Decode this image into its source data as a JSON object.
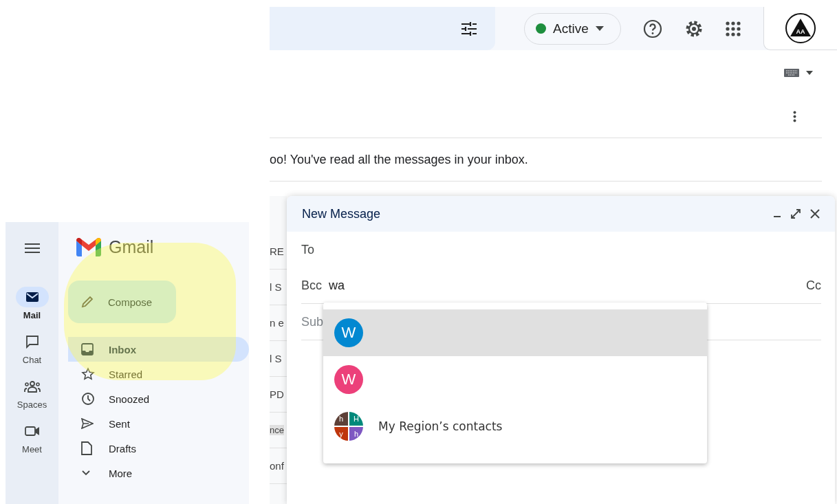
{
  "top_bar": {
    "status": {
      "label": "Active",
      "color": "#1e8e3e"
    },
    "account_logo": {
      "text": "AA"
    }
  },
  "mail_view": {
    "message": "oo! You've read all the messages in your inbox.",
    "list_fragments": [
      {
        "text": "RE",
        "kind": "text"
      },
      {
        "text": "l S",
        "kind": "text"
      },
      {
        "text": "n e",
        "kind": "text"
      },
      {
        "text": "l S",
        "kind": "text"
      },
      {
        "text": "PD",
        "kind": "text"
      },
      {
        "text": "nce",
        "kind": "chip"
      },
      {
        "text": "onf",
        "kind": "text"
      }
    ]
  },
  "left_rail": {
    "items": [
      {
        "label": "Mail",
        "kind": "mail",
        "selected": true
      },
      {
        "label": "Chat",
        "kind": "chat",
        "selected": false
      },
      {
        "label": "Spaces",
        "kind": "spaces",
        "selected": false
      },
      {
        "label": "Meet",
        "kind": "meet",
        "selected": false
      }
    ]
  },
  "nav": {
    "app_name": "Gmail",
    "compose": "Compose",
    "folders": [
      {
        "label": "Inbox",
        "kind": "inbox",
        "selected": true
      },
      {
        "label": "Starred",
        "kind": "star",
        "selected": false
      },
      {
        "label": "Snoozed",
        "kind": "clock",
        "selected": false
      },
      {
        "label": "Sent",
        "kind": "send",
        "selected": false
      },
      {
        "label": "Drafts",
        "kind": "file",
        "selected": false
      },
      {
        "label": "More",
        "kind": "chevron",
        "selected": false
      }
    ]
  },
  "compose_window": {
    "title": "New Message",
    "to_label": "To",
    "bcc_label": "Bcc",
    "bcc_value": "wa",
    "cc_label": "Cc",
    "subject_placeholder": "Sub",
    "suggestions": [
      {
        "kind": "person",
        "initial": "W",
        "color": "#0288d1",
        "selected": true
      },
      {
        "kind": "person",
        "initial": "W",
        "color": "#ec407a",
        "selected": false
      },
      {
        "kind": "group",
        "label": "My Region’s contacts",
        "selected": false,
        "tiles": [
          {
            "letter": "h",
            "color": "#5d4037"
          },
          {
            "letter": "H",
            "color": "#00897b"
          },
          {
            "letter": "y",
            "color": "#bf360c"
          },
          {
            "letter": "h",
            "color": "#7e57c2"
          }
        ]
      }
    ]
  }
}
